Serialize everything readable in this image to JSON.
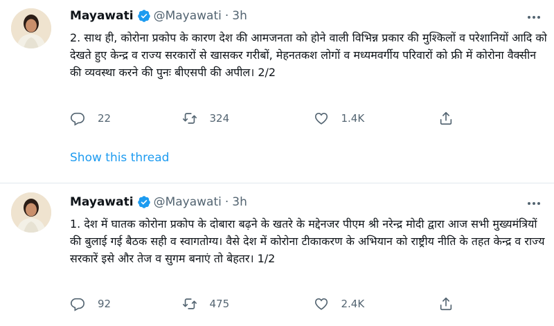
{
  "tweets": [
    {
      "author": {
        "name": "Mayawati",
        "handle": "@Mayawati",
        "separator": "·",
        "time": "3h",
        "verified": true
      },
      "text": "2. साथ ही, कोरोना प्रकोप के कारण देश की आमजनता को होने वाली विभिन्न प्रकार की मुश्किलों व परेशानियों आदि को देखते हुए केन्द्र व राज्य सरकारों से खासकर गरीबों, मेहनतकश लोगों व मध्यमवर्गीय परिवारों को फ्री में कोरोना वैक्सीन की व्यवस्था करने की पुनः बीएसपी की अपील। 2/2",
      "stats": {
        "replies": "22",
        "retweets": "324",
        "likes": "1.4K"
      },
      "show_thread": "Show this thread"
    },
    {
      "author": {
        "name": "Mayawati",
        "handle": "@Mayawati",
        "separator": "·",
        "time": "3h",
        "verified": true
      },
      "text": "1. देश में घातक कोरोना प्रकोप के दोबारा बढ़ने के खतरे के मद्देनजर पीएम श्री नरेन्द्र मोदी द्वारा आज सभी मुख्यमंत्रियों की बुलाई गई बैठक सही व स्वागतोग्य। वैसे देश में कोरोना टीकाकरण के अभियान को राष्ट्रीय नीति के तहत केन्द्र व राज्य सरकारें इसे और तेज व सुगम बनाएं तो बेहतर। 1/2",
      "stats": {
        "replies": "92",
        "retweets": "475",
        "likes": "2.4K"
      }
    }
  ],
  "icons": {
    "verified": "verified-badge-icon",
    "more": "more-options-icon",
    "reply": "reply-icon",
    "retweet": "retweet-icon",
    "like": "like-icon",
    "share": "share-icon"
  },
  "colors": {
    "accent": "#1d9bf0",
    "text": "#0f1419",
    "muted": "#536471",
    "divider": "#e1e8ed"
  }
}
